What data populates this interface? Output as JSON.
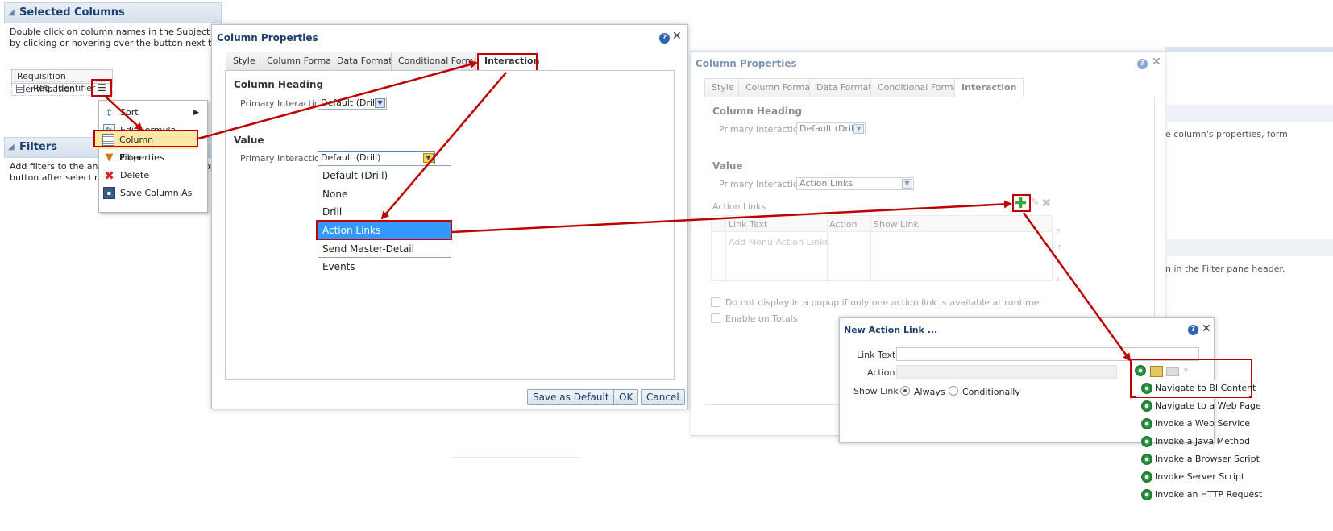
{
  "left_panel": {
    "selected_columns_title": "Selected Columns",
    "help_line1": "Double click on column names in the Subject Areas pane",
    "help_line2": "by clicking or hovering over the button next to its name",
    "column_group": "Requisition Identification",
    "column_name": "Req. Identifier",
    "filters_title": "Filters",
    "filters_line1": "Add filters to the analys",
    "filters_line1_tail": "r opt",
    "filters_line2": "button after selecting it",
    "context_menu": [
      "Sort",
      "Edit Formula",
      "Column Properties",
      "Filter",
      "Delete",
      "Save Column As"
    ]
  },
  "dialog1": {
    "title": "Column Properties",
    "tabs": [
      "Style",
      "Column Format",
      "Data Format",
      "Conditional Format",
      "Interaction"
    ],
    "column_heading": "Column Heading",
    "primary_interaction_label": "Primary Interaction",
    "heading_value": "Default (Drill)",
    "value_section": "Value",
    "value_value": "Default (Drill)",
    "dropdown_options": [
      "Default (Drill)",
      "None",
      "Drill",
      "Action Links",
      "Send Master-Detail Events"
    ],
    "save_default": "Save as Default",
    "ok": "OK",
    "cancel": "Cancel"
  },
  "dialog2": {
    "title": "Column Properties",
    "tabs": [
      "Style",
      "Column Format",
      "Data Format",
      "Conditional Format",
      "Interaction"
    ],
    "column_heading": "Column Heading",
    "primary_interaction_label": "Primary Interaction",
    "heading_value": "Default (Drill)",
    "value_section": "Value",
    "value_value": "Action Links",
    "action_links_label": "Action Links",
    "grid_headers": [
      "Link Text",
      "Action",
      "Show Link"
    ],
    "grid_placeholder": "Add Menu Action Links",
    "checkbox1": "Do not display in a popup if only one action link is available at runtime",
    "checkbox2": "Enable on Totals"
  },
  "background_text": {
    "right1": "e column's properties, form",
    "right2": "n in the Filter pane header."
  },
  "dialog3": {
    "title": "New Action Link ...",
    "link_text_label": "Link Text",
    "action_label": "Action",
    "show_link_label": "Show Link",
    "always": "Always",
    "conditionally": "Conditionally"
  },
  "action_menu": [
    "Navigate to BI Content",
    "Navigate to a Web Page",
    "Invoke a Web Service",
    "Invoke a Java Method",
    "Invoke a Browser Script",
    "Invoke Server Script",
    "Invoke an HTTP Request"
  ],
  "colors": {
    "annotation_red": "#c00000",
    "title_blue": "#1a3e6e",
    "highlight_blue": "#3399ff"
  }
}
